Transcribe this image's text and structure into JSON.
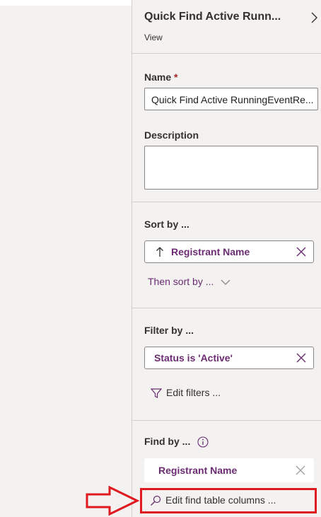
{
  "panel": {
    "title": "Quick Find Active Runn...",
    "subtitle": "View"
  },
  "name_field": {
    "label": "Name",
    "required_mark": "*",
    "value": "Quick Find Active RunningEventRe..."
  },
  "description_field": {
    "label": "Description",
    "value": ""
  },
  "sort": {
    "label": "Sort by ...",
    "item": "Registrant Name",
    "then_sort": "Then sort by ..."
  },
  "filter": {
    "label": "Filter by ...",
    "item": "Status is 'Active'",
    "edit_filters": "Edit filters ..."
  },
  "find": {
    "label": "Find by ...",
    "item": "Registrant Name",
    "edit_columns": "Edit find table columns ..."
  },
  "colors": {
    "accent": "#6b2c72",
    "annotation": "#e0181f",
    "panel_bg": "#f3f2f1"
  },
  "icons": [
    "chevron-right-icon",
    "up-arrow-icon",
    "close-icon",
    "chevron-down-icon",
    "filter-icon",
    "info-icon",
    "search-icon",
    "annotation-arrow-icon"
  ]
}
